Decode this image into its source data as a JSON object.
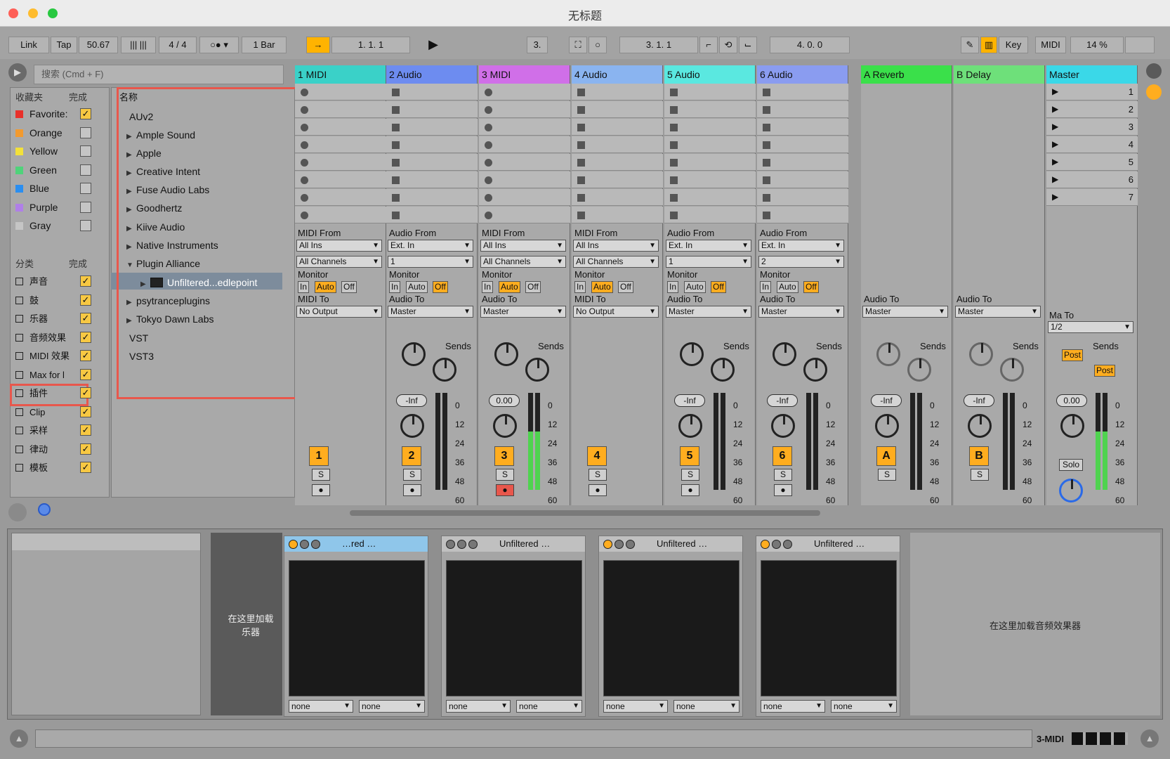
{
  "window": {
    "title": "无标题"
  },
  "transport": {
    "link": "Link",
    "tap": "Tap",
    "tempo": "50.67",
    "sig": "4 / 4",
    "quant": "1 Bar",
    "pos": "1.   1.   1",
    "loop_start": "3.   1.   1",
    "loop_len": "4.   0.   0",
    "key": "Key",
    "midi": "MIDI",
    "cpu": "14 %",
    "pos2": "3."
  },
  "browser": {
    "search_placeholder": "搜索 (Cmd + F)",
    "collections_header": "收藏夹",
    "done": "完成",
    "collections": [
      "Favorite:",
      "Orange",
      "Yellow",
      "Green",
      "Blue",
      "Purple",
      "Gray"
    ],
    "collection_colors": [
      "#e8302a",
      "#f29a2e",
      "#f3e13a",
      "#4fd37a",
      "#2a8ef0",
      "#b07fe8",
      "#c5c5c5"
    ],
    "categories_header": "分类",
    "categories": [
      "声音",
      "鼓",
      "乐器",
      "音频效果",
      "MIDI 效果",
      "Max for l",
      "插件",
      "Clip",
      "采样",
      "律动",
      "模板"
    ],
    "name_header": "名称",
    "tree": [
      "AUv2",
      "Ample Sound",
      "Apple",
      "Creative Intent",
      "Fuse Audio Labs",
      "Goodhertz",
      "Kiive Audio",
      "Native Instruments",
      "Plugin Alliance",
      "Unfiltered...edlepoint",
      "psytranceplugins",
      "Tokyo Dawn Labs",
      "VST",
      "VST3"
    ]
  },
  "tracks": [
    {
      "name": "1 MIDI",
      "color": "#3ad1c8",
      "from_label": "MIDI From",
      "from": "All Ins",
      "ch": "All Channels",
      "to_label": "MIDI To",
      "to": "No Output",
      "num": "1"
    },
    {
      "name": "2 Audio",
      "color": "#6d8cf0",
      "from_label": "Audio From",
      "from": "Ext. In",
      "ch": "1",
      "to_label": "Audio To",
      "to": "Master",
      "num": "2",
      "vol": "-Inf"
    },
    {
      "name": "3 MIDI",
      "color": "#d06fe8",
      "from_label": "MIDI From",
      "from": "All Ins",
      "ch": "All Channels",
      "to_label": "Audio To",
      "to": "Master",
      "num": "3",
      "vol": "0.00"
    },
    {
      "name": "4 Audio",
      "color": "#8ab4f0",
      "from_label": "MIDI From",
      "from": "All Ins",
      "ch": "All Channels",
      "to_label": "MIDI To",
      "to": "No Output",
      "num": "4"
    },
    {
      "name": "5 Audio",
      "color": "#5ae8e0",
      "from_label": "Audio From",
      "from": "Ext. In",
      "ch": "1",
      "to_label": "Audio To",
      "to": "Master",
      "num": "5",
      "vol": "-Inf"
    },
    {
      "name": "6 Audio",
      "color": "#8a9cf0",
      "from_label": "Audio From",
      "from": "Ext. In",
      "ch": "2",
      "to_label": "Audio To",
      "to": "Master",
      "num": "6",
      "vol": "-Inf"
    }
  ],
  "returns": [
    {
      "name": "A Reverb",
      "color": "#3ae04a",
      "to_label": "Audio To",
      "to": "Master",
      "num": "A",
      "vol": "-Inf"
    },
    {
      "name": "B Delay",
      "color": "#6ee07a",
      "to_label": "Audio To",
      "to": "Master",
      "num": "B",
      "vol": "-Inf"
    }
  ],
  "master": {
    "name": "Master",
    "color": "#3ad8e8",
    "vol": "0.00",
    "solo": "Solo",
    "post": "Post",
    "to_label": "Ma  To",
    "to": "1/2",
    "scenes": [
      "1",
      "2",
      "3",
      "4",
      "5",
      "6",
      "7"
    ]
  },
  "labels": {
    "monitor": "Monitor",
    "in": "In",
    "auto": "Auto",
    "off": "Off",
    "sends": "Sends",
    "s": "S",
    "a": "A",
    "b": "B"
  },
  "scale": [
    "0",
    "12",
    "24",
    "36",
    "48",
    "60"
  ],
  "devices": {
    "instrument_drop": "在这里加载乐器",
    "fx_drop": "在这里加载音频效果器",
    "items": [
      {
        "name": "…red …"
      },
      {
        "name": "Unfiltered …"
      },
      {
        "name": "Unfiltered …"
      },
      {
        "name": "Unfiltered …"
      }
    ],
    "none": "none"
  },
  "status": {
    "track": "3-MIDI"
  }
}
